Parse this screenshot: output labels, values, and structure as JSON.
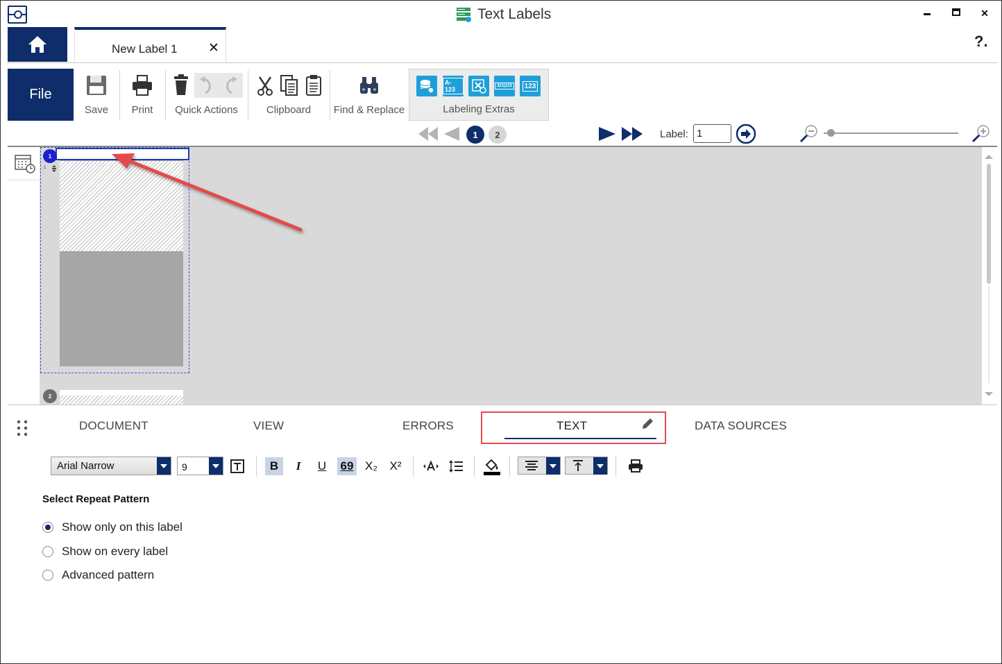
{
  "window": {
    "title": "Text Labels",
    "minimize_glyph": "▁",
    "maximize_glyph": "■",
    "close_glyph": "✕"
  },
  "doc_tab": {
    "label": "New Label 1",
    "close_glyph": "✕"
  },
  "help": "?.",
  "ribbon": {
    "file": "File",
    "save": "Save",
    "print": "Print",
    "quick_actions": "Quick Actions",
    "clipboard": "Clipboard",
    "find_replace": "Find & Replace",
    "labeling_extras": "Labeling Extras",
    "extras_buttons": [
      "A-123",
      "321|123",
      "123"
    ]
  },
  "navigation": {
    "pages": [
      "1",
      "2"
    ],
    "current_page": "1",
    "label_caption": "Label:",
    "label_value": "1"
  },
  "canvas": {
    "label_badges": [
      "1",
      "2"
    ],
    "row_marker": "1"
  },
  "panel_tabs": [
    "DOCUMENT",
    "VIEW",
    "ERRORS",
    "TEXT",
    "DATA SOURCES"
  ],
  "active_panel_tab": "TEXT",
  "format": {
    "font": "Arial Narrow",
    "size": "9",
    "bold": "B",
    "italic": "I",
    "underline": "U",
    "ligature": "69",
    "subscript": "X₂",
    "superscript": "X²"
  },
  "repeat_pattern": {
    "title": "Select Repeat Pattern",
    "options": [
      "Show only on this label",
      "Show on every label",
      "Advanced pattern"
    ],
    "selected": 0
  },
  "colors": {
    "brand_navy": "#0f2d6b",
    "accent_cyan": "#1f9fd8",
    "annotation_red": "#e24c4c",
    "selection_blue": "#1f3db8"
  }
}
